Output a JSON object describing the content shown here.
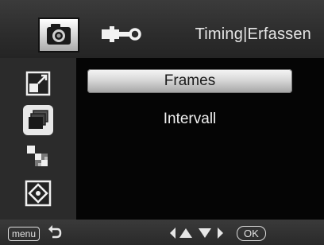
{
  "header": {
    "title": "Timing|Erfassen",
    "tabs": [
      {
        "icon": "camera-icon",
        "selected": true
      },
      {
        "icon": "wrench-icon",
        "selected": false
      }
    ]
  },
  "sidebar": {
    "items": [
      {
        "icon": "resize-icon"
      },
      {
        "icon": "burst-frames-icon",
        "selected": true
      },
      {
        "icon": "checkered-pattern-icon"
      },
      {
        "icon": "focus-target-icon"
      }
    ]
  },
  "main": {
    "items": [
      {
        "label": "Frames",
        "selected": true
      },
      {
        "label": "Intervall",
        "selected": false
      }
    ]
  },
  "footer": {
    "menu_label": "menu",
    "back_icon": "return-arrow-icon",
    "nav_icon": "direction-arrows-icon",
    "ok_label": "OK"
  },
  "colors": {
    "background": "#000000",
    "bar": "#2f2f2f",
    "selected_highlight": "#d8d8d8",
    "text": "#f0f0f0"
  }
}
